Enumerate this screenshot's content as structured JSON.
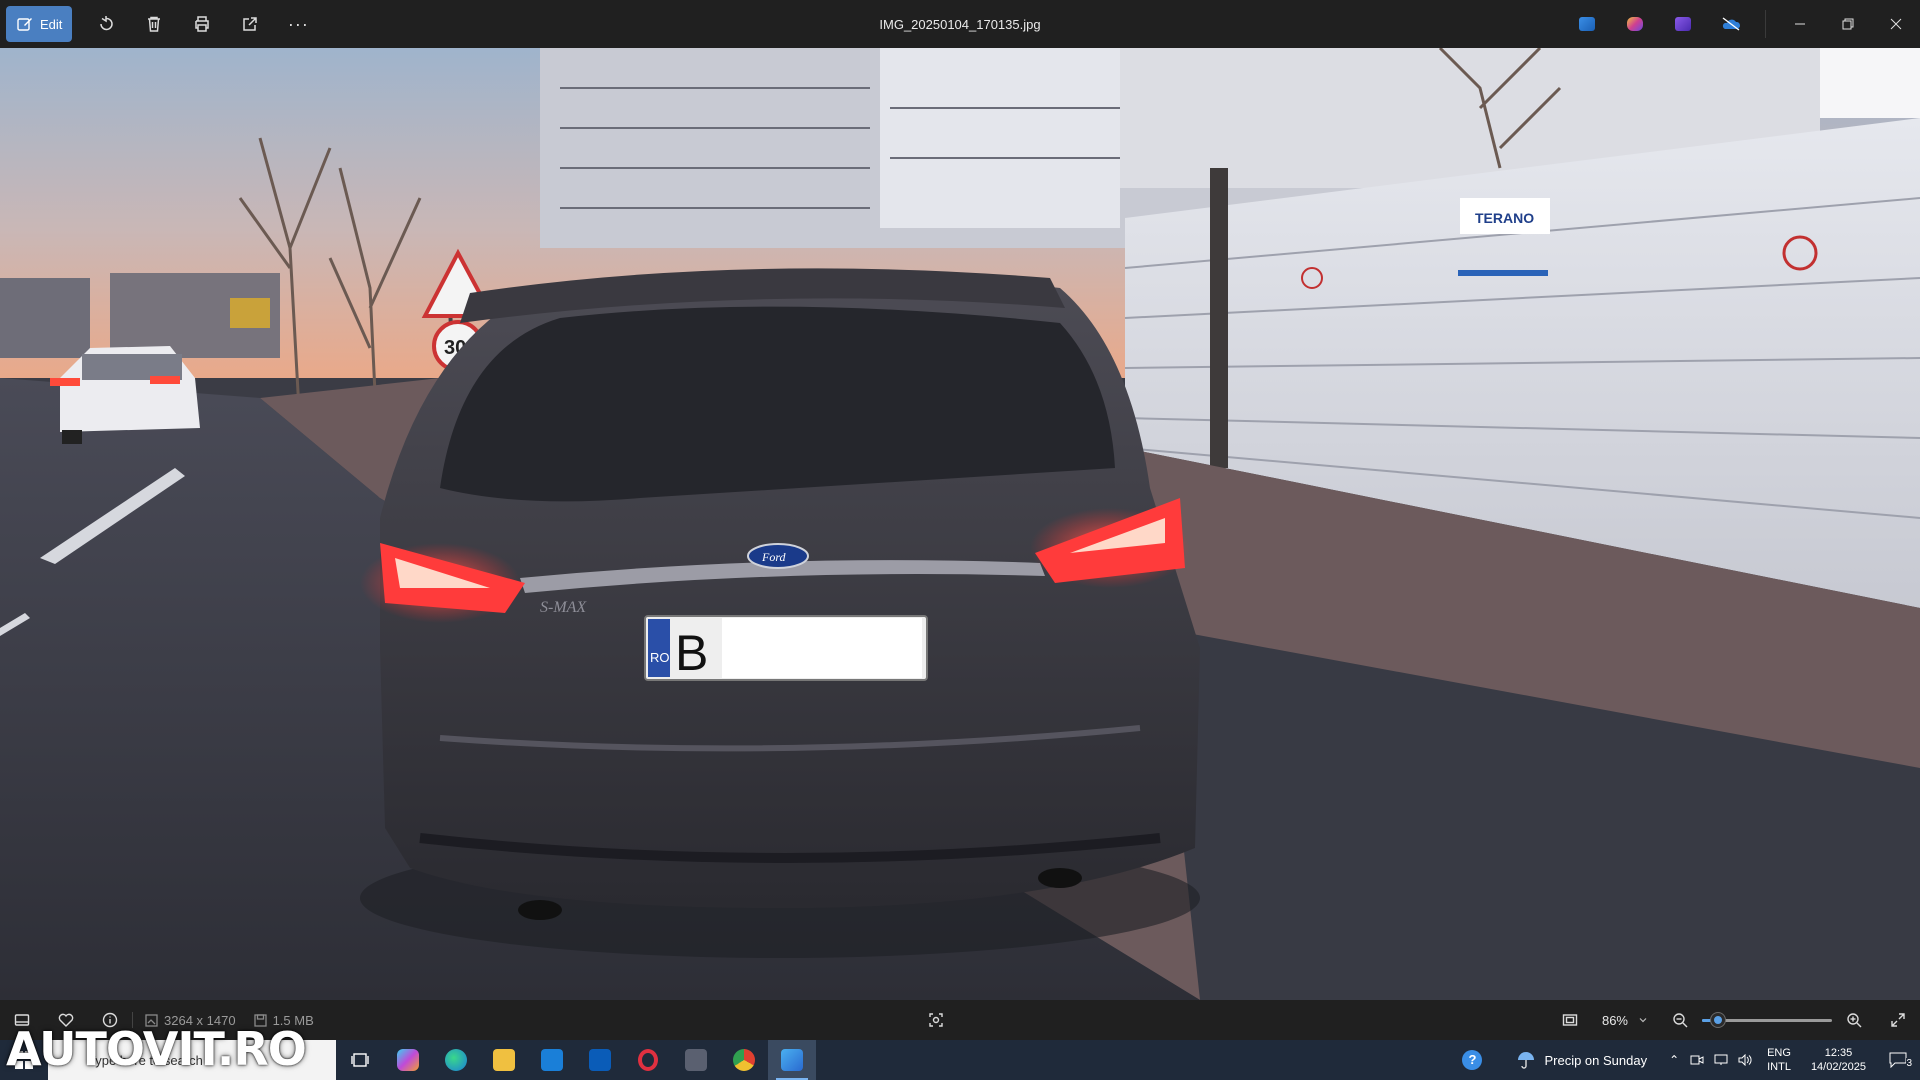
{
  "window": {
    "title": "IMG_20250104_170135.jpg",
    "edit_label": "Edit"
  },
  "toolbar": {
    "icons": [
      "rotate-icon",
      "delete-icon",
      "print-icon",
      "share-icon",
      "more-icon"
    ],
    "more_label": "···"
  },
  "photo": {
    "plate_prefix": "B",
    "plate_country": "RO",
    "sign_text": "TERANO",
    "badge_text": "Ford",
    "model_text": "S-MAX",
    "speed_sign": "30"
  },
  "status": {
    "dimensions": "3264 x 1470",
    "file_size": "1.5 MB",
    "zoom": "86%",
    "zoom_fraction": 0.12
  },
  "taskbar": {
    "search_placeholder": "Type here to search",
    "weather": "Precip on Sunday",
    "lang_top": "ENG",
    "lang_bottom": "INTL",
    "time": "12:35",
    "date": "14/02/2025",
    "notifications": "3"
  },
  "watermark": "AUTOVIT.RO",
  "colors": {
    "accent": "#4a7fc1",
    "slider": "#5aa0e6",
    "taillight": "#ff3b3b"
  }
}
